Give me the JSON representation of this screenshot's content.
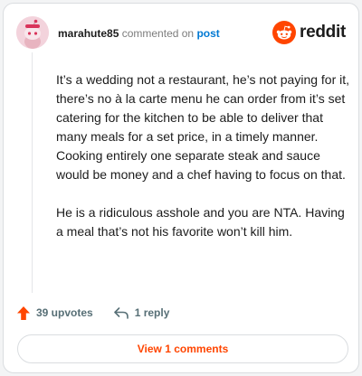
{
  "comment": {
    "username": "marahute85",
    "action_text": "commented on",
    "post_link": "post",
    "paragraphs": [
      "It’s a wedding not a restaurant, he’s not paying for it, there’s no à la carte menu he can order from it’s set catering for the kitchen to be able to deliver that many meals for a set price, in a timely manner. Cooking entirely one separate steak and sauce would be money and a chef having to focus on that.",
      "He is a ridiculous asshole and you are NTA. Having a meal that’s not his favorite won’t kill him."
    ],
    "upvotes": "39 upvotes",
    "replies": "1 reply",
    "view_comments": "View 1 comments"
  },
  "brand": {
    "name": "reddit"
  },
  "icons": {
    "avatar": "snoo-avatar-icon",
    "brand": "reddit-logo-icon",
    "upvote": "upvote-arrow-icon",
    "reply": "reply-arrow-icon"
  },
  "colors": {
    "accent": "#ff4500",
    "link": "#0079d3",
    "text": "#1c1c1c",
    "muted": "#576f76"
  }
}
